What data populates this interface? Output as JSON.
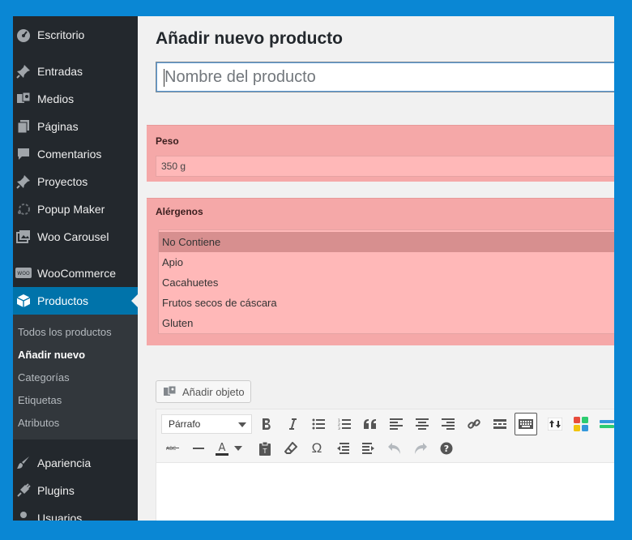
{
  "sidebar": {
    "items": [
      {
        "label": "Escritorio",
        "icon": "dashboard-icon"
      },
      {
        "label": "Entradas",
        "icon": "pin-icon"
      },
      {
        "label": "Medios",
        "icon": "media-icon"
      },
      {
        "label": "Páginas",
        "icon": "pages-icon"
      },
      {
        "label": "Comentarios",
        "icon": "comment-icon"
      },
      {
        "label": "Proyectos",
        "icon": "pin-icon"
      },
      {
        "label": "Popup Maker",
        "icon": "popup-icon"
      },
      {
        "label": "Woo Carousel",
        "icon": "gallery-icon"
      },
      {
        "label": "WooCommerce",
        "icon": "woo-icon"
      },
      {
        "label": "Productos",
        "icon": "cube-icon"
      },
      {
        "label": "Apariencia",
        "icon": "brush-icon"
      },
      {
        "label": "Plugins",
        "icon": "plug-icon"
      },
      {
        "label": "Usuarios",
        "icon": "user-icon"
      }
    ],
    "submenu": [
      "Todos los productos",
      "Añadir nuevo",
      "Categorías",
      "Etiquetas",
      "Atributos"
    ]
  },
  "main": {
    "title": "Añadir nuevo producto",
    "name_placeholder": "Nombre del producto",
    "peso": {
      "label": "Peso",
      "value": "350 g"
    },
    "alergenos": {
      "label": "Alérgenos",
      "options": [
        "No Contiene",
        "Apio",
        "Cacahuetes",
        "Frutos secos de cáscara",
        "Gluten"
      ],
      "selected": "No Contiene"
    },
    "add_media_label": "Añadir objeto",
    "editor": {
      "format_value": "Párrafo"
    }
  },
  "colors": {
    "accent": "#0073aa",
    "frame": "#0a87d4",
    "acf_box": "#f5a8a8"
  }
}
